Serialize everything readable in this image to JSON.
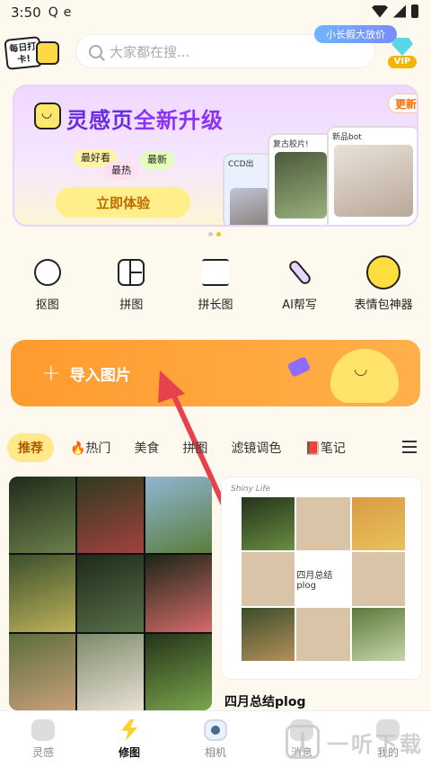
{
  "status_bar": {
    "time": "3:50"
  },
  "header": {
    "checkin_label": "每日打卡!",
    "search_placeholder": "大家都在搜...",
    "promo_pill": "小长假大放价",
    "vip_label": "VIP"
  },
  "banner": {
    "title_part1": "灵感页",
    "title_part2": "全新升级",
    "tags": [
      "最好看",
      "最热",
      "最新"
    ],
    "cta": "立即体验",
    "update_badge": "更新",
    "cards": [
      "CCD出",
      "复古胶片!",
      "新品bot"
    ]
  },
  "tools": [
    {
      "label": "抠图",
      "icon": "cutout-icon"
    },
    {
      "label": "拼图",
      "icon": "collage-icon"
    },
    {
      "label": "拼长图",
      "icon": "long-image-icon"
    },
    {
      "label": "AI帮写",
      "icon": "ai-pen-icon"
    },
    {
      "label": "表情包神器",
      "icon": "sticker-icon"
    }
  ],
  "import_button": {
    "label": "导入图片"
  },
  "tabs": [
    "推荐",
    "🔥热门",
    "美食",
    "拼图",
    "滤镜调色",
    "📕笔记"
  ],
  "feed": {
    "right_card_title": "四月总结plog",
    "right_card_header": "Shiny Life",
    "right_card_center": "四月总结plog"
  },
  "bottom_nav": [
    {
      "label": "灵感",
      "icon": "inspiration-icon",
      "active": false
    },
    {
      "label": "修图",
      "icon": "edit-bolt-icon",
      "active": true
    },
    {
      "label": "相机",
      "icon": "camera-icon",
      "active": false
    },
    {
      "label": "消息",
      "icon": "message-icon",
      "active": false
    },
    {
      "label": "我的",
      "icon": "profile-icon",
      "active": false
    }
  ],
  "watermark": "一听下载",
  "colors": {
    "accent": "#ff9b2f",
    "brand_purple": "#8a33ff",
    "arrow": "#e8414e"
  }
}
